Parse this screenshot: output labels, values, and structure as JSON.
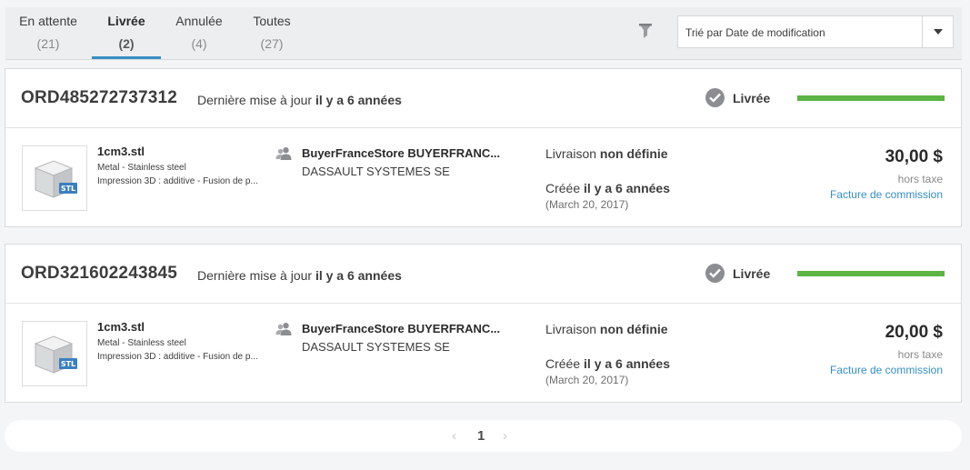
{
  "tabs": [
    {
      "label": "En attente",
      "count": "(21)"
    },
    {
      "label": "Livrée",
      "count": "(2)"
    },
    {
      "label": "Annulée",
      "count": "(4)"
    },
    {
      "label": "Toutes",
      "count": "(27)"
    }
  ],
  "active_tab": "Livrée",
  "sort": {
    "value": "Trié par Date de modification"
  },
  "icons": {
    "filter": "filter-funnel-icon",
    "dropdown": "chevron-down-icon",
    "status": "check-circle-icon",
    "buyer": "users-icon",
    "file": "stl-cube-icon"
  },
  "colors": {
    "progress": "#5bb443",
    "link": "#368ec4",
    "active_tab_underline": "#368ec4"
  },
  "orders": [
    {
      "id": "ORD485272737312",
      "updated_label": "Dernière mise à jour",
      "updated_value": "il y a 6 années",
      "status": "Livrée",
      "progress": 1.0,
      "file": {
        "name": "1cm3.stl",
        "material": "Metal - Stainless steel",
        "process": "Impression 3D : additive - Fusion de p..."
      },
      "buyer": "BuyerFranceStore BUYERFRANC...",
      "company": "DASSAULT SYSTEMES SE",
      "delivery_label": "Livraison",
      "delivery_value": "non définie",
      "created_label": "Créée",
      "created_value": "il y a 6 années",
      "created_date": "(March 20, 2017)",
      "price": "30,00 $",
      "tax_note": "hors taxe",
      "invoice_link": "Facture de commission"
    },
    {
      "id": "ORD321602243845",
      "updated_label": "Dernière mise à jour",
      "updated_value": "il y a 6 années",
      "status": "Livrée",
      "progress": 1.0,
      "file": {
        "name": "1cm3.stl",
        "material": "Metal - Stainless steel",
        "process": "Impression 3D : additive - Fusion de p..."
      },
      "buyer": "BuyerFranceStore BUYERFRANC...",
      "company": "DASSAULT SYSTEMES SE",
      "delivery_label": "Livraison",
      "delivery_value": "non définie",
      "created_label": "Créée",
      "created_value": "il y a 6 années",
      "created_date": "(March 20, 2017)",
      "price": "20,00 $",
      "tax_note": "hors taxe",
      "invoice_link": "Facture de commission"
    }
  ],
  "pagination": {
    "prev": "‹",
    "current": "1",
    "next": "›"
  }
}
